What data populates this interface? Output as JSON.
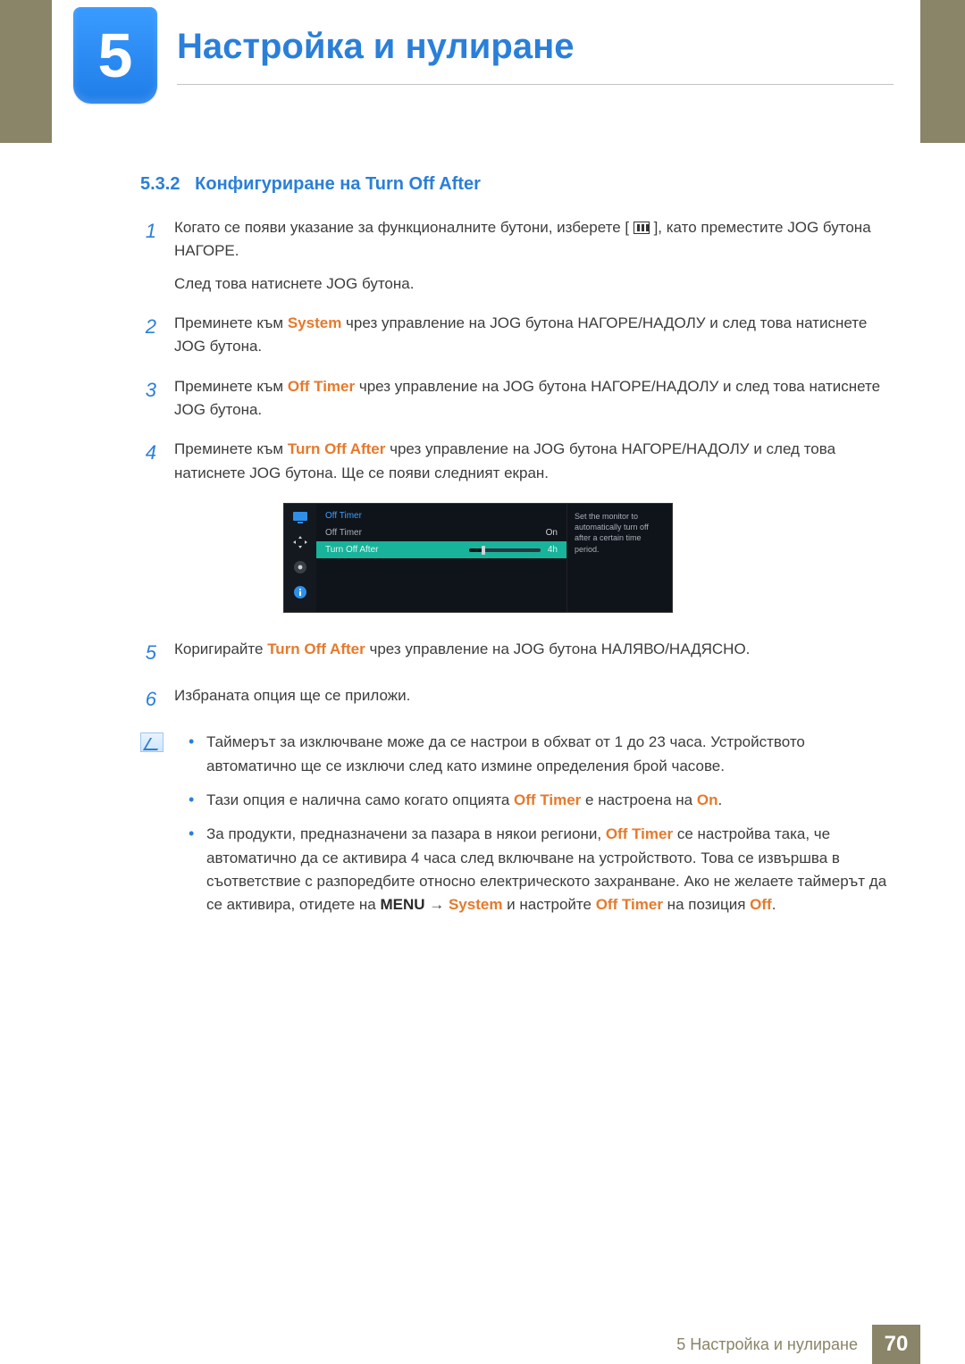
{
  "header": {
    "chapter_number": "5",
    "chapter_title": "Настройка и нулиране"
  },
  "section": {
    "number": "5.3.2",
    "title": "Конфигуриране на Turn Off After"
  },
  "steps": [
    {
      "n": "1",
      "pre": "Когато се появи указание за функционалните бутони, изберете [",
      "post": "], като преместите JOG бутона НАГОРЕ.",
      "sub": "След това натиснете JOG бутона."
    },
    {
      "n": "2",
      "parts": [
        "Преминете към ",
        "System",
        " чрез управление на JOG бутона НАГОРЕ/НАДОЛУ и след това натиснете JOG бутона."
      ]
    },
    {
      "n": "3",
      "parts": [
        "Преминете към ",
        "Off Timer",
        " чрез управление на JOG бутона НАГОРЕ/НАДОЛУ и след това натиснете JOG бутона."
      ]
    },
    {
      "n": "4",
      "parts": [
        "Преминете към ",
        "Turn Off After",
        " чрез управление на JOG бутона НАГОРЕ/НАДОЛУ и след това натиснете JOG бутона. Ще се появи следният екран."
      ]
    },
    {
      "n": "5",
      "parts": [
        "Коригирайте ",
        "Turn Off After",
        " чрез управление на JOG бутона НАЛЯВО/НАДЯСНО."
      ]
    },
    {
      "n": "6",
      "parts": [
        "Избраната опция ще се приложи."
      ]
    }
  ],
  "osd": {
    "header": "Off Timer",
    "row1_label": "Off Timer",
    "row1_value": "On",
    "row2_label": "Turn Off After",
    "row2_value": "4h",
    "help": "Set the monitor to automatically turn off after a certain time period."
  },
  "notes": [
    {
      "parts": [
        "Таймерът за изключване може да се настрои в обхват от 1 до 23 часа. Устройството автоматично ще се изключи след като измине определения брой часове."
      ]
    },
    {
      "parts": [
        "Тази опция е налична само когато опцията ",
        "Off Timer",
        " е настроена на ",
        "On",
        "."
      ]
    },
    {
      "parts": [
        "За продукти, предназначени за пазара в някои региони, ",
        "Off Timer",
        " се настройва така, че автоматично да се активира 4 часа след включване на устройството. Това се извършва в съответствие с разпоредбите относно електрическото захранване. Ако не желаете таймерът да се активира, отидете на ",
        "MENU",
        "  →  ",
        "System",
        " и настройте ",
        "Off Timer",
        " на позиция ",
        "Off",
        "."
      ]
    }
  ],
  "footer": {
    "label": "5 Настройка и нулиране",
    "page": "70"
  }
}
